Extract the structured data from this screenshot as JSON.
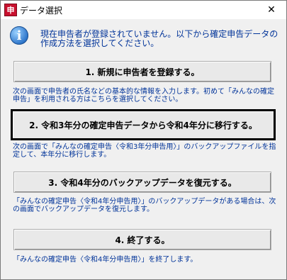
{
  "window": {
    "title": "データ選択",
    "app_icon_glyph": "申",
    "close_glyph": "✕"
  },
  "intro": {
    "icon_glyph": "i",
    "text": "現在申告者が登録されていません。以下から確定申告データの作成方法を選択してください。"
  },
  "options": [
    {
      "label": "1. 新規に申告者を登録する。",
      "description": "次の画面で申告者の氏名などの基本的な情報を入力します。初めて「みんなの確定申告」を利用される方はこちらを選択してください。"
    },
    {
      "label": "2. 令和3年分の確定申告データから令和4年分に移行する。",
      "description": "次の画面で「みんなの確定申告〈令和3年分申告用〉」のバックアップファイルを指定して、本年分に移行します。"
    },
    {
      "label": "3. 令和4年分のバックアップデータを復元する。",
      "description": "「みんなの確定申告〈令和4年分申告用〉」のバックアップデータがある場合は、次の画面でバックアップデータを復元します。"
    },
    {
      "label": "4. 終了する。",
      "description": "「みんなの確定申告〈令和4年分申告用〉」を終了します。"
    }
  ],
  "colors": {
    "description_text": "#003399",
    "background": "#f0f0f0"
  }
}
